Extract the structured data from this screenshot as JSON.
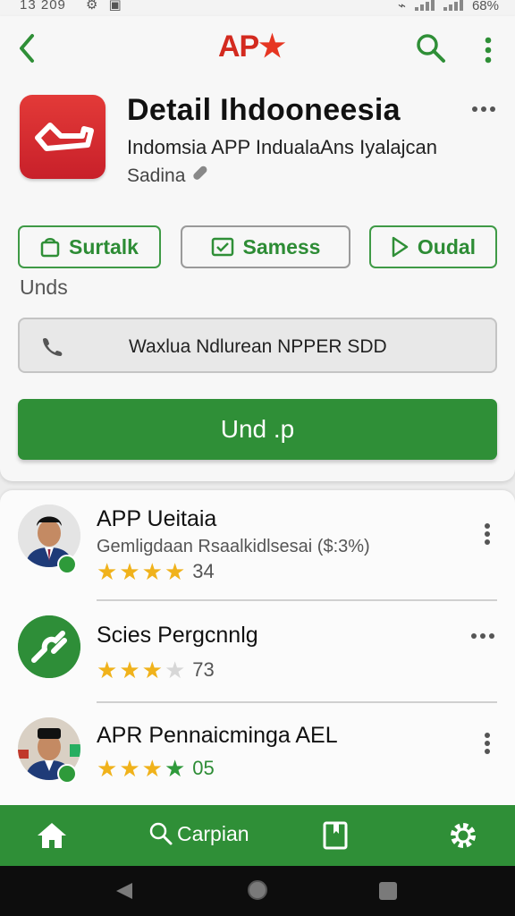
{
  "status_bar": {
    "time": "13 209",
    "battery": "68%",
    "icons": [
      "settings-icon",
      "notification-icon",
      "wifi-icon",
      "signal-icon"
    ]
  },
  "app_bar": {
    "logo_text": "AP",
    "icons": [
      "back-arrow-icon",
      "search-icon",
      "kebab-menu-icon"
    ]
  },
  "detail": {
    "title": "Detail Ihdooneesia",
    "subtitle": "Indomsia APP IndualaAns Iyalajcan",
    "developer": "Sadina",
    "app_icon": "red-app-icon"
  },
  "actions": [
    {
      "label": "Surtalk",
      "icon": "bag-icon"
    },
    {
      "label": "Samess",
      "icon": "chart-check-icon"
    },
    {
      "label": "Oudal",
      "icon": "play-icon"
    }
  ],
  "section_label": "Unds",
  "field": {
    "value": "Waxlua Ndlurean NPPER SDD",
    "icon": "phone-icon"
  },
  "primary_button": {
    "label": "Und .p"
  },
  "list": [
    {
      "title": "APP Ueitaia",
      "meta": "Gemligdaan Rsaalkidlsesai ($:3%)",
      "rating": "34",
      "stars": 4,
      "menu": "vertical"
    },
    {
      "title": "Scies Pergcnnlg",
      "meta": "",
      "rating": "73",
      "stars": 3,
      "menu": "horizontal"
    },
    {
      "title": "APR Pennaicminga AEL",
      "meta": "",
      "rating": "05",
      "stars": 4,
      "menu": "vertical"
    }
  ],
  "bottom_nav": {
    "search_label": "Carpian",
    "icons": [
      "home-icon",
      "search-icon",
      "bookmark-icon",
      "settings-icon"
    ]
  },
  "colors": {
    "accent": "#2f8f37",
    "brand_red": "#d32a1f",
    "star": "#f0b21b"
  }
}
